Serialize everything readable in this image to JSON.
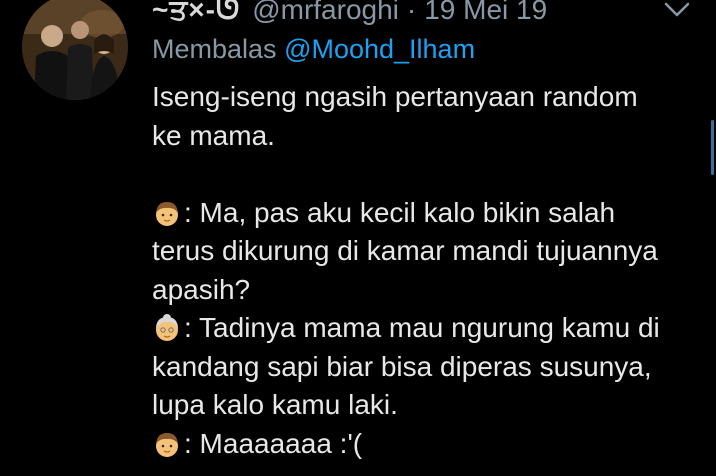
{
  "tweet": {
    "display_name": "~ਤ×-ᘎ",
    "handle": "@mrfaroghi",
    "separator": "·",
    "date": "19 Mei 19",
    "reply_prefix": "Membalas",
    "reply_mention": "@Moohd_Ilham",
    "intro_line1": "Iseng-iseng ngasih pertanyaan random",
    "intro_line2": "ke mama.",
    "dialogue": [
      {
        "speaker_icon": "boy-emoji-icon",
        "line1": ": Ma, pas aku kecil kalo bikin salah",
        "line2": "terus dikurung di kamar mandi tujuannya",
        "line3": "apasih?"
      },
      {
        "speaker_icon": "older-woman-emoji-icon",
        "line1": ": Tadinya mama mau ngurung kamu di",
        "line2": "kandang sapi biar bisa diperas susunya,",
        "line3": "lupa kalo kamu laki."
      },
      {
        "speaker_icon": "boy-emoji-icon",
        "line1": ": Maaaaaaa :'("
      }
    ]
  },
  "colors": {
    "background": "#000000",
    "text": "#e8e8e8",
    "secondary": "#8899a6",
    "link": "#1da1f2"
  },
  "icons": {
    "menu": "chevron-down-icon",
    "avatar": "avatar"
  }
}
